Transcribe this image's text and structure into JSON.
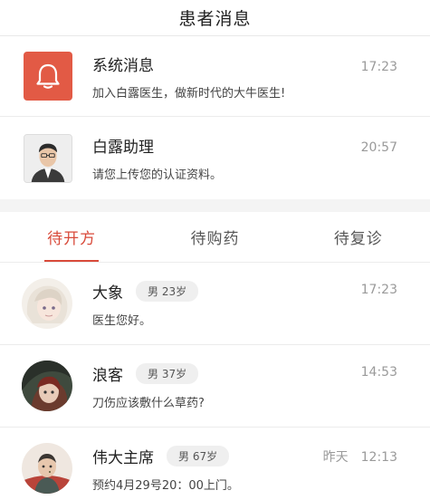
{
  "header": {
    "title": "患者消息"
  },
  "system_messages": [
    {
      "name": "系统消息",
      "preview": "加入白露医生，做新时代的大牛医生!",
      "time": "17:23",
      "icon": "bell-icon"
    },
    {
      "name": "白露助理",
      "preview": "请您上传您的认证资料。",
      "time": "20:57",
      "icon": "assistant-avatar"
    }
  ],
  "tabs": [
    {
      "label": "待开方",
      "active": true
    },
    {
      "label": "待购药",
      "active": false
    },
    {
      "label": "待复诊",
      "active": false
    }
  ],
  "patients": [
    {
      "name": "大象",
      "badge": "男 23岁",
      "message": "医生您好。",
      "time": "17:23",
      "day": ""
    },
    {
      "name": "浪客",
      "badge": "男 37岁",
      "message": "刀伤应该敷什么草药?",
      "time": "14:53",
      "day": ""
    },
    {
      "name": "伟大主席",
      "badge": "男 67岁",
      "message": "预约4月29号20：00上门。",
      "time": "12:13",
      "day": "昨天"
    }
  ],
  "colors": {
    "accent": "#d84a3a",
    "bell_bg": "#e25a45"
  }
}
